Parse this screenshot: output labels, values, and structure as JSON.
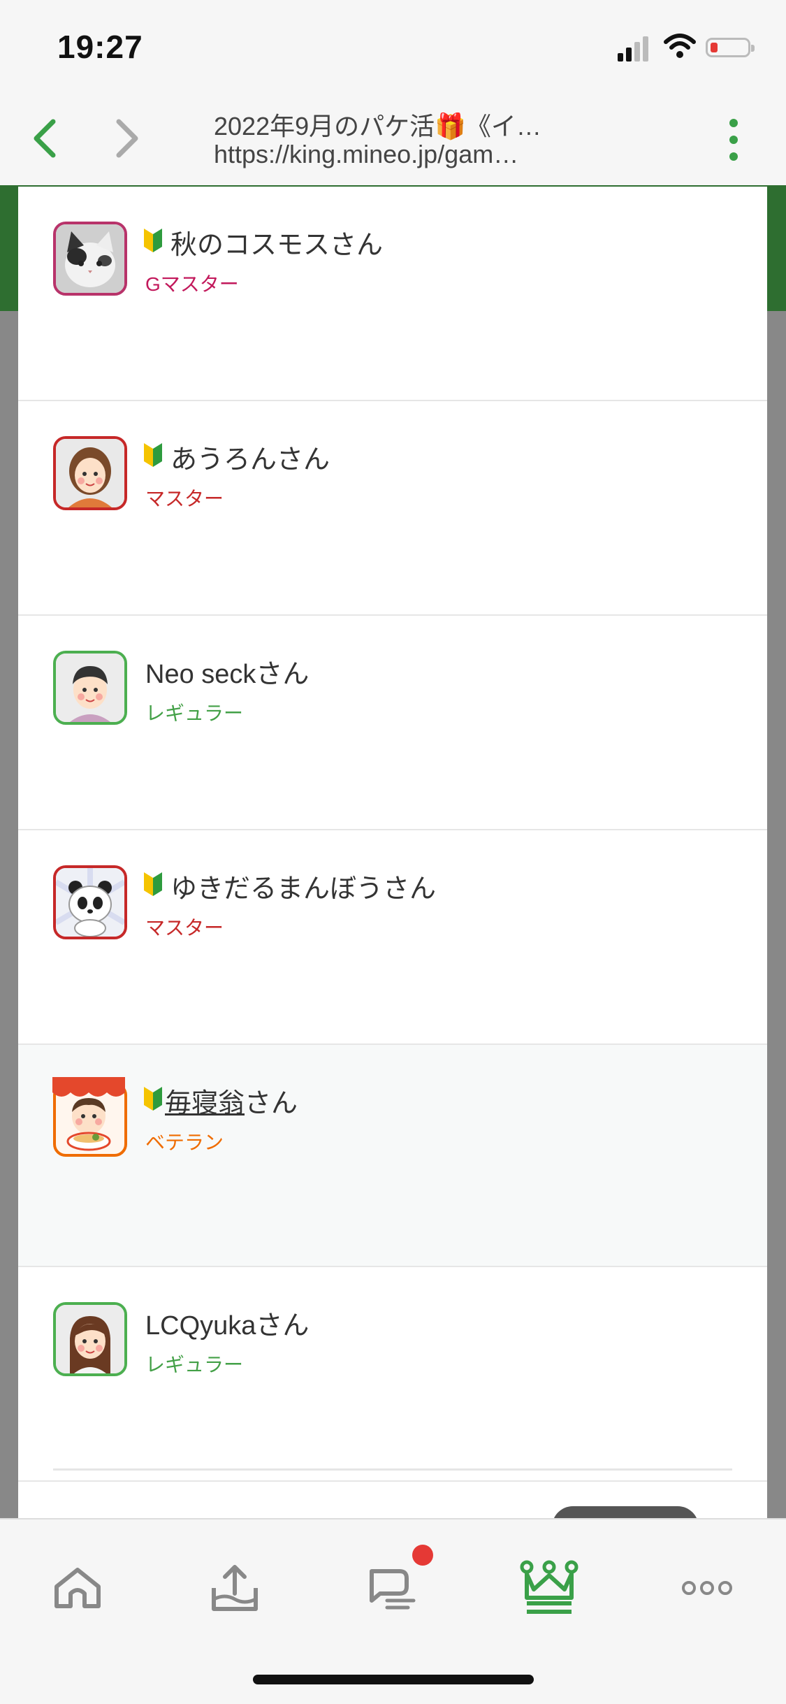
{
  "status_bar": {
    "time": "19:27"
  },
  "browser": {
    "title": "2022年9月のパケ活🎁《イ…",
    "url": "https://king.mineo.jp/gam…"
  },
  "members": [
    {
      "name": "秋のコスモスさん",
      "rank": "Gマスター",
      "rank_color": "#c2185b",
      "beginner": true,
      "avatar_border": "#b8336a",
      "avatar": "cat-photo"
    },
    {
      "name": "あうろんさん",
      "rank": "マスター",
      "rank_color": "#c62828",
      "beginner": true,
      "avatar_border": "#c62828",
      "avatar": "woman"
    },
    {
      "name": "Neo seckさん",
      "rank": "レギュラー",
      "rank_color": "#43a047",
      "beginner": false,
      "avatar_border": "#4caf50",
      "avatar": "man"
    },
    {
      "name": "ゆきだるまんぼうさん",
      "rank": "マスター",
      "rank_color": "#c62828",
      "beginner": true,
      "avatar_border": "#c62828",
      "avatar": "panda"
    },
    {
      "name_link": "毎寝翁",
      "name_suffix": "さん",
      "rank": "ベテラン",
      "rank_color": "#ef6c00",
      "beginner": true,
      "avatar_border": "#ef6c00",
      "avatar": "ramen-shop"
    },
    {
      "name": "LCQyukaさん",
      "rank": "レギュラー",
      "rank_color": "#43a047",
      "beginner": false,
      "avatar_border": "#4caf50",
      "avatar": "woman-long-hair"
    }
  ],
  "colors": {
    "accent": "#3aa048",
    "notification": "#e53935"
  },
  "tab_bar": {
    "items": [
      "home-icon",
      "upload-icon",
      "chat-icon",
      "crown-icon",
      "more-icon"
    ],
    "active": "crown-icon"
  }
}
